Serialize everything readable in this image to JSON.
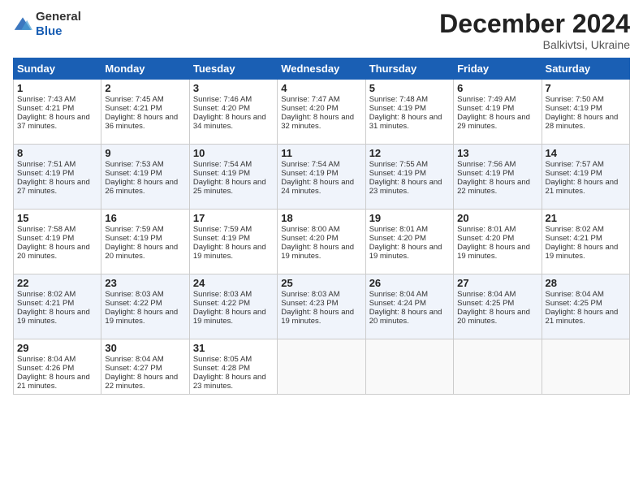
{
  "header": {
    "logo_line1": "General",
    "logo_line2": "Blue",
    "month": "December 2024",
    "location": "Balkivtsi, Ukraine"
  },
  "weekdays": [
    "Sunday",
    "Monday",
    "Tuesday",
    "Wednesday",
    "Thursday",
    "Friday",
    "Saturday"
  ],
  "weeks": [
    [
      {
        "day": "1",
        "rise": "7:43 AM",
        "set": "4:21 PM",
        "daylight": "8 hours and 37 minutes."
      },
      {
        "day": "2",
        "rise": "7:45 AM",
        "set": "4:21 PM",
        "daylight": "8 hours and 36 minutes."
      },
      {
        "day": "3",
        "rise": "7:46 AM",
        "set": "4:20 PM",
        "daylight": "8 hours and 34 minutes."
      },
      {
        "day": "4",
        "rise": "7:47 AM",
        "set": "4:20 PM",
        "daylight": "8 hours and 32 minutes."
      },
      {
        "day": "5",
        "rise": "7:48 AM",
        "set": "4:19 PM",
        "daylight": "8 hours and 31 minutes."
      },
      {
        "day": "6",
        "rise": "7:49 AM",
        "set": "4:19 PM",
        "daylight": "8 hours and 29 minutes."
      },
      {
        "day": "7",
        "rise": "7:50 AM",
        "set": "4:19 PM",
        "daylight": "8 hours and 28 minutes."
      }
    ],
    [
      {
        "day": "8",
        "rise": "7:51 AM",
        "set": "4:19 PM",
        "daylight": "8 hours and 27 minutes."
      },
      {
        "day": "9",
        "rise": "7:53 AM",
        "set": "4:19 PM",
        "daylight": "8 hours and 26 minutes."
      },
      {
        "day": "10",
        "rise": "7:54 AM",
        "set": "4:19 PM",
        "daylight": "8 hours and 25 minutes."
      },
      {
        "day": "11",
        "rise": "7:54 AM",
        "set": "4:19 PM",
        "daylight": "8 hours and 24 minutes."
      },
      {
        "day": "12",
        "rise": "7:55 AM",
        "set": "4:19 PM",
        "daylight": "8 hours and 23 minutes."
      },
      {
        "day": "13",
        "rise": "7:56 AM",
        "set": "4:19 PM",
        "daylight": "8 hours and 22 minutes."
      },
      {
        "day": "14",
        "rise": "7:57 AM",
        "set": "4:19 PM",
        "daylight": "8 hours and 21 minutes."
      }
    ],
    [
      {
        "day": "15",
        "rise": "7:58 AM",
        "set": "4:19 PM",
        "daylight": "8 hours and 20 minutes."
      },
      {
        "day": "16",
        "rise": "7:59 AM",
        "set": "4:19 PM",
        "daylight": "8 hours and 20 minutes."
      },
      {
        "day": "17",
        "rise": "7:59 AM",
        "set": "4:19 PM",
        "daylight": "8 hours and 19 minutes."
      },
      {
        "day": "18",
        "rise": "8:00 AM",
        "set": "4:20 PM",
        "daylight": "8 hours and 19 minutes."
      },
      {
        "day": "19",
        "rise": "8:01 AM",
        "set": "4:20 PM",
        "daylight": "8 hours and 19 minutes."
      },
      {
        "day": "20",
        "rise": "8:01 AM",
        "set": "4:20 PM",
        "daylight": "8 hours and 19 minutes."
      },
      {
        "day": "21",
        "rise": "8:02 AM",
        "set": "4:21 PM",
        "daylight": "8 hours and 19 minutes."
      }
    ],
    [
      {
        "day": "22",
        "rise": "8:02 AM",
        "set": "4:21 PM",
        "daylight": "8 hours and 19 minutes."
      },
      {
        "day": "23",
        "rise": "8:03 AM",
        "set": "4:22 PM",
        "daylight": "8 hours and 19 minutes."
      },
      {
        "day": "24",
        "rise": "8:03 AM",
        "set": "4:22 PM",
        "daylight": "8 hours and 19 minutes."
      },
      {
        "day": "25",
        "rise": "8:03 AM",
        "set": "4:23 PM",
        "daylight": "8 hours and 19 minutes."
      },
      {
        "day": "26",
        "rise": "8:04 AM",
        "set": "4:24 PM",
        "daylight": "8 hours and 20 minutes."
      },
      {
        "day": "27",
        "rise": "8:04 AM",
        "set": "4:25 PM",
        "daylight": "8 hours and 20 minutes."
      },
      {
        "day": "28",
        "rise": "8:04 AM",
        "set": "4:25 PM",
        "daylight": "8 hours and 21 minutes."
      }
    ],
    [
      {
        "day": "29",
        "rise": "8:04 AM",
        "set": "4:26 PM",
        "daylight": "8 hours and 21 minutes."
      },
      {
        "day": "30",
        "rise": "8:04 AM",
        "set": "4:27 PM",
        "daylight": "8 hours and 22 minutes."
      },
      {
        "day": "31",
        "rise": "8:05 AM",
        "set": "4:28 PM",
        "daylight": "8 hours and 23 minutes."
      },
      null,
      null,
      null,
      null
    ]
  ]
}
